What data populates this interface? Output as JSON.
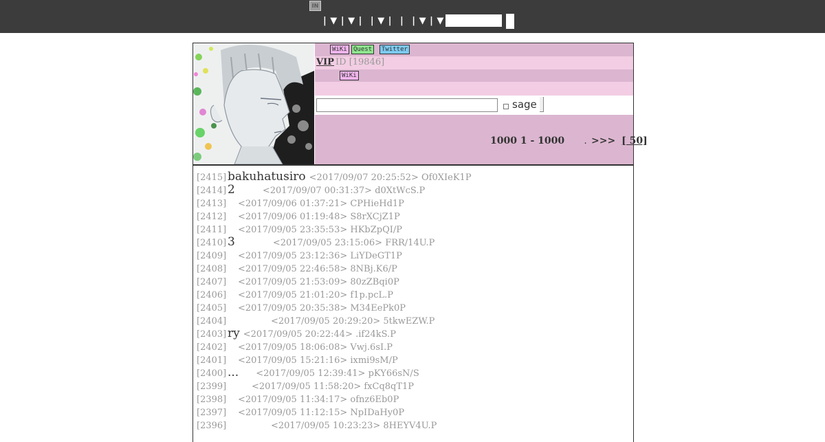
{
  "top_bar": {
    "logo_text": "IN",
    "nav_separators": [
      "|",
      "▼",
      "|",
      "▼",
      "|",
      "|",
      "▼",
      "|",
      "|",
      "|",
      "▼",
      "|",
      "▼",
      "|",
      "▼",
      "|"
    ],
    "search_value": "",
    "button_label": ""
  },
  "header": {
    "badges_row1": [
      "WiKi",
      "Quest",
      "Twitter"
    ],
    "board_name": "VIP",
    "thread_id": "ID [19846]",
    "badge_row3": "WiKi",
    "message_value": "",
    "sage_label": "sage",
    "count_text": "1000  1  - 1000",
    "pager_dot": ".",
    "pager_next": ">>>",
    "pager_last": "[ 50]"
  },
  "colors": {
    "topbar_bg": "#3c3c3c",
    "header_dark": "#dcb6d0",
    "header_light": "#f2cde3",
    "badge_wiki": "#f0b4ec",
    "badge_quest": "#8fe58f",
    "badge_twitter": "#7cc9f0"
  },
  "posts": [
    {
      "num": "[2415]",
      "title": "bakuhatusiro",
      "meta": "<2017/09/07 20:25:52> Of0XIeK1P"
    },
    {
      "num": "[2414]",
      "title": "2",
      "meta": "<2017/09/07 00:31:37> d0XtWcS.P"
    },
    {
      "num": "[2413]",
      "title": "",
      "meta": "<2017/09/06 01:37:21> CPHieHd1P"
    },
    {
      "num": "[2412]",
      "title": "",
      "meta": "<2017/09/06 01:19:48> S8rXCjZ1P"
    },
    {
      "num": "[2411]",
      "title": "",
      "meta": "<2017/09/05 23:35:53> HKbZpQI/P"
    },
    {
      "num": "[2410]",
      "title": "3",
      "meta": "<2017/09/05 23:15:06> FRR/14U.P"
    },
    {
      "num": "[2409]",
      "title": "",
      "meta": "<2017/09/05 23:12:36> LiYDeGT1P"
    },
    {
      "num": "[2408]",
      "title": "",
      "meta": "<2017/09/05 22:46:58> 8NBj.K6/P"
    },
    {
      "num": "[2407]",
      "title": "",
      "meta": "<2017/09/05 21:53:09> 80zZBqi0P"
    },
    {
      "num": "[2406]",
      "title": "",
      "meta": "<2017/09/05 21:01:20> f1p.pcL.P"
    },
    {
      "num": "[2405]",
      "title": "",
      "meta": "<2017/09/05 20:35:38> M34EePk0P"
    },
    {
      "num": "[2404]",
      "title": "",
      "meta": "<2017/09/05 20:29:20> 5tkwEZW.P"
    },
    {
      "num": "[2403]",
      "title": "ry",
      "meta": "<2017/09/05 20:22:44> .if24kS.P"
    },
    {
      "num": "[2402]",
      "title": "",
      "meta": "<2017/09/05 18:06:08> Vwj.6sI.P"
    },
    {
      "num": "[2401]",
      "title": "",
      "meta": "<2017/09/05 15:21:16> ixmi9sM/P"
    },
    {
      "num": "[2400]",
      "title": "...",
      "meta": "<2017/09/05 12:39:41> pKY66sN/S"
    },
    {
      "num": "[2399]",
      "title": "",
      "meta": "<2017/09/05 11:58:20> fxCq8qT1P"
    },
    {
      "num": "[2398]",
      "title": "",
      "meta": "<2017/09/05 11:34:17> ofnz6Eb0P"
    },
    {
      "num": "[2397]",
      "title": "",
      "meta": "<2017/09/05 11:12:15> NpIDaHy0P"
    },
    {
      "num": "[2396]",
      "title": "",
      "meta": "<2017/09/05 10:23:23> 8HEYV4U.P"
    }
  ]
}
